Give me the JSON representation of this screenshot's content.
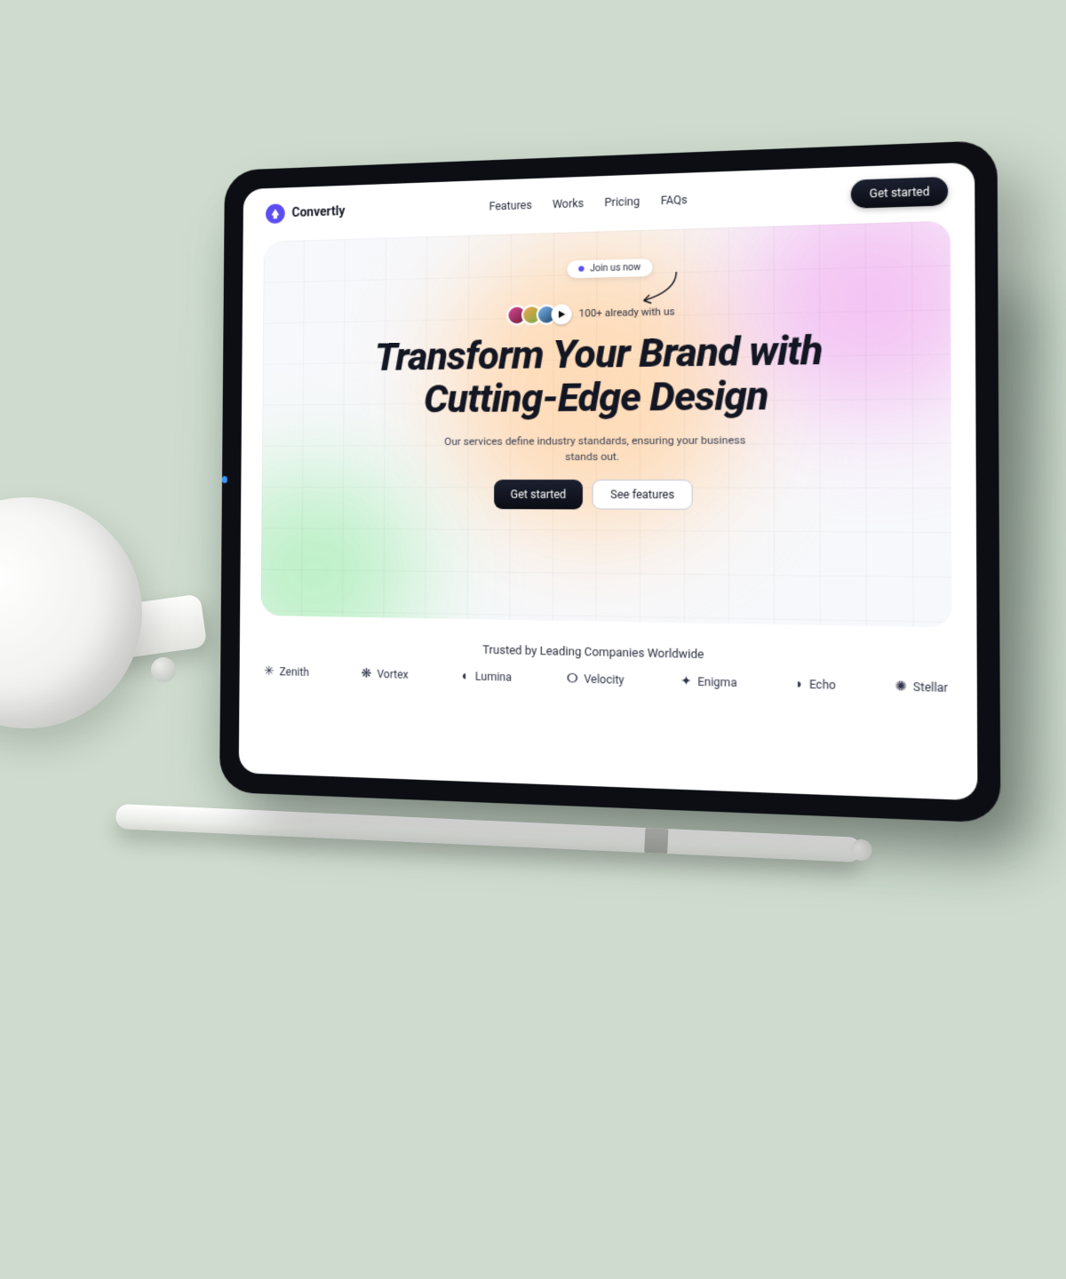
{
  "brand": {
    "name": "Convertly"
  },
  "nav": {
    "items": [
      "Features",
      "Works",
      "Pricing",
      "FAQs"
    ]
  },
  "cta": {
    "label": "Get started"
  },
  "hero": {
    "join_chip": "Join us now",
    "social_proof": "100+ already with us",
    "title_line1": "Transform Your Brand with",
    "title_line2": "Cutting-Edge Design",
    "subtitle": "Our services define industry standards, ensuring your business stands out.",
    "primary_cta": "Get started",
    "secondary_cta": "See features"
  },
  "trust": {
    "label": "Trusted by Leading Companies Worldwide",
    "logos": [
      {
        "icon": "✳",
        "name": "Zenith"
      },
      {
        "icon": "❋",
        "name": "Vortex"
      },
      {
        "icon": "◐",
        "name": "Lumina"
      },
      {
        "icon": "ⵔ",
        "name": "Velocity"
      },
      {
        "icon": "✦",
        "name": "Enigma"
      },
      {
        "icon": "◗",
        "name": "Echo"
      },
      {
        "icon": "✺",
        "name": "Stellar"
      }
    ]
  }
}
